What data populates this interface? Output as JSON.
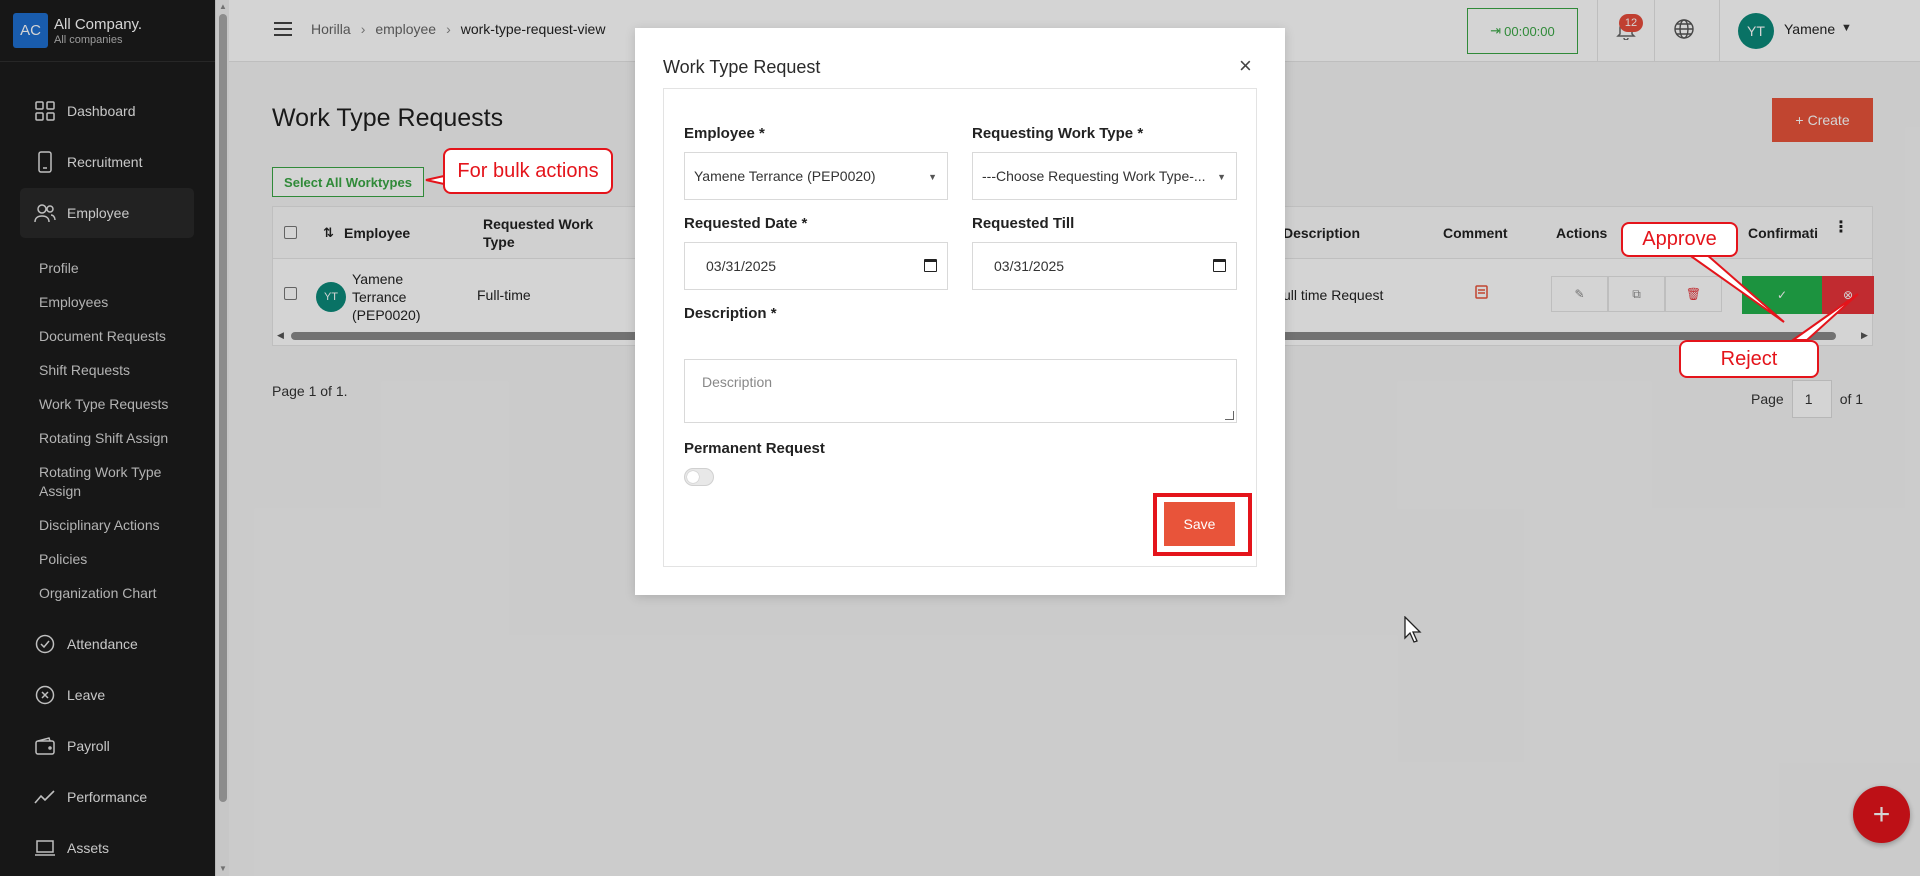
{
  "company": {
    "logo_text": "AC",
    "name": "All Company.",
    "sub": "All companies"
  },
  "sidebar": {
    "main_items": [
      {
        "label": "Dashboard",
        "icon": "grid-icon"
      },
      {
        "label": "Recruitment",
        "icon": "phone-icon"
      },
      {
        "label": "Employee",
        "icon": "users-icon"
      }
    ],
    "employee_sub": [
      "Profile",
      "Employees",
      "Document Requests",
      "Shift Requests",
      "Work Type Requests",
      "Rotating Shift Assign",
      "Rotating Work Type Assign",
      "Disciplinary Actions",
      "Policies",
      "Organization Chart"
    ],
    "bottom_items": [
      {
        "label": "Attendance",
        "icon": "check-circle-icon"
      },
      {
        "label": "Leave",
        "icon": "x-circle-icon"
      },
      {
        "label": "Payroll",
        "icon": "wallet-icon"
      },
      {
        "label": "Performance",
        "icon": "trend-icon"
      },
      {
        "label": "Assets",
        "icon": "laptop-icon"
      }
    ]
  },
  "header": {
    "breadcrumb": [
      "Horilla",
      "employee",
      "work-type-request-view"
    ],
    "timer": "00:00:00",
    "notifications": "12",
    "user_initials": "YT",
    "user_name": "Yamene"
  },
  "page": {
    "title": "Work Type Requests",
    "create_label": "Create",
    "select_all_label": "Select All Worktypes",
    "columns": {
      "employee": "Employee",
      "requested_work_type": "Requested Work Type",
      "description": "Description",
      "comment": "Comment",
      "actions": "Actions",
      "confirmation": "Confirmati"
    },
    "row": {
      "initials": "YT",
      "employee": "Yamene Terrance (PEP0020)",
      "work_type": "Full-time",
      "description": "ull time Request"
    },
    "page_info": "Page 1 of 1.",
    "pager": {
      "label": "Page",
      "value": "1",
      "of": "of 1"
    }
  },
  "annotations": {
    "bulk": "For bulk actions",
    "approve": "Approve",
    "reject": "Reject"
  },
  "modal": {
    "title": "Work Type Request",
    "employee_label": "Employee",
    "employee_value": "Yamene Terrance (PEP0020)",
    "work_type_label": "Requesting Work Type",
    "work_type_placeholder": "---Choose Requesting Work Type-...",
    "req_date_label": "Requested Date",
    "req_date_value": "03/31/2025",
    "req_till_label": "Requested Till",
    "req_till_value": "03/31/2025",
    "description_label": "Description",
    "description_placeholder": "Description",
    "permanent_label": "Permanent Request",
    "permanent_on": false,
    "save_label": "Save",
    "required_mark": "*"
  },
  "colors": {
    "accent": "#e8543a",
    "success": "#22b14c",
    "danger": "#e8343a",
    "annotation": "#e4141b",
    "sidebar": "#1c1c1c"
  }
}
